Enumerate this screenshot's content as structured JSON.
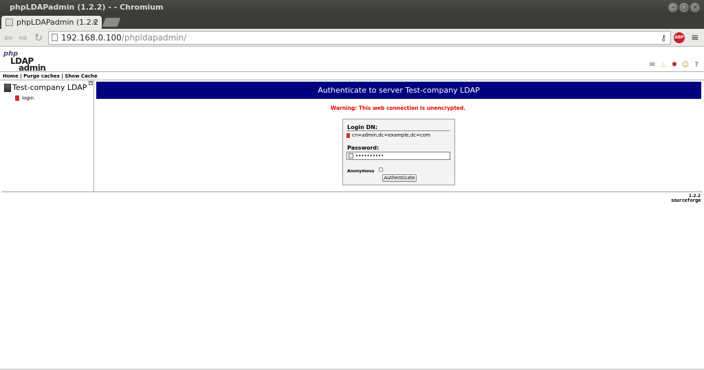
{
  "window": {
    "title": "phpLDAPadmin (1.2.2) - - Chromium"
  },
  "browser": {
    "tab_title": "phpLDAPadmin (1.2.2",
    "tab_close": "×",
    "url_host": "192.168.0.100",
    "url_path": "/phpldapadmin/",
    "abp_label": "ABP"
  },
  "logo": {
    "php": "php",
    "ldap": "LDAP",
    "admin": "admin"
  },
  "topnav": {
    "home": "Home",
    "purge": "Purge caches",
    "show_cache": "Show Cache",
    "sep": " | "
  },
  "sidebar": {
    "server_name": "Test-company LDAP",
    "login_label": "login"
  },
  "main": {
    "banner": "Authenticate to server Test-company LDAP",
    "warning": "Warning: This web connection is unencrypted."
  },
  "login_form": {
    "dn_label": "Login DN:",
    "dn_value": "cn=admin,dc=example,dc=com",
    "password_label": "Password:",
    "password_value": "••••••••••",
    "anonymous_label": "Anonymous",
    "submit_label": "Authenticate"
  },
  "footer": {
    "version": "1.2.2",
    "sourceforge": "sourceforge"
  }
}
